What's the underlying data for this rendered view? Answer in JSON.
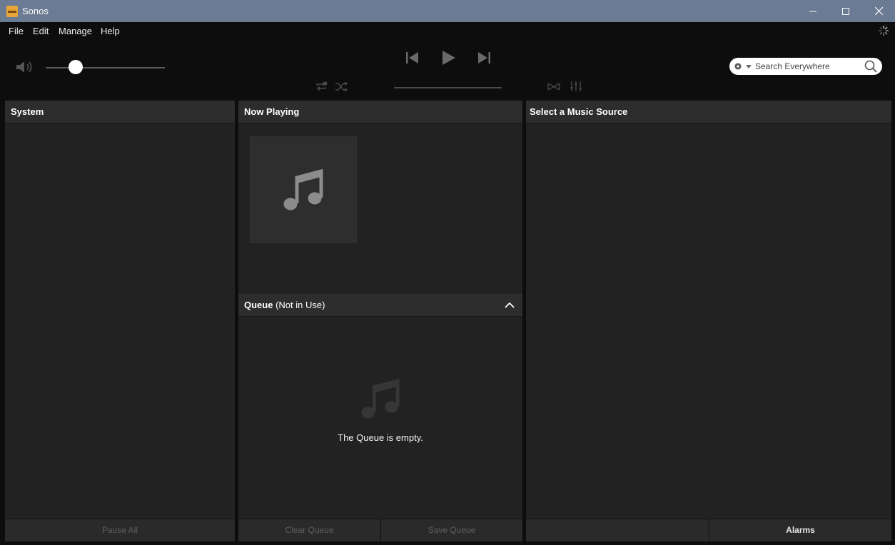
{
  "window": {
    "title": "Sonos"
  },
  "menu": {
    "items": [
      "File",
      "Edit",
      "Manage",
      "Help"
    ]
  },
  "search": {
    "placeholder": "Search Everywhere"
  },
  "panels": {
    "system": {
      "title": "System",
      "pause_all": "Pause All"
    },
    "now_playing": {
      "title": "Now Playing"
    },
    "queue": {
      "title": "Queue",
      "status": "(Not in Use)",
      "empty_message": "The Queue is empty.",
      "clear": "Clear Queue",
      "save": "Save Queue"
    },
    "music_source": {
      "title": "Select a Music Source",
      "alarms": "Alarms"
    }
  },
  "volume": {
    "level": 0.25
  },
  "colors": {
    "titlebar": "#6b7b93",
    "panel": "#222222",
    "header": "#2d2d2d",
    "accent": "#e8a53a"
  }
}
